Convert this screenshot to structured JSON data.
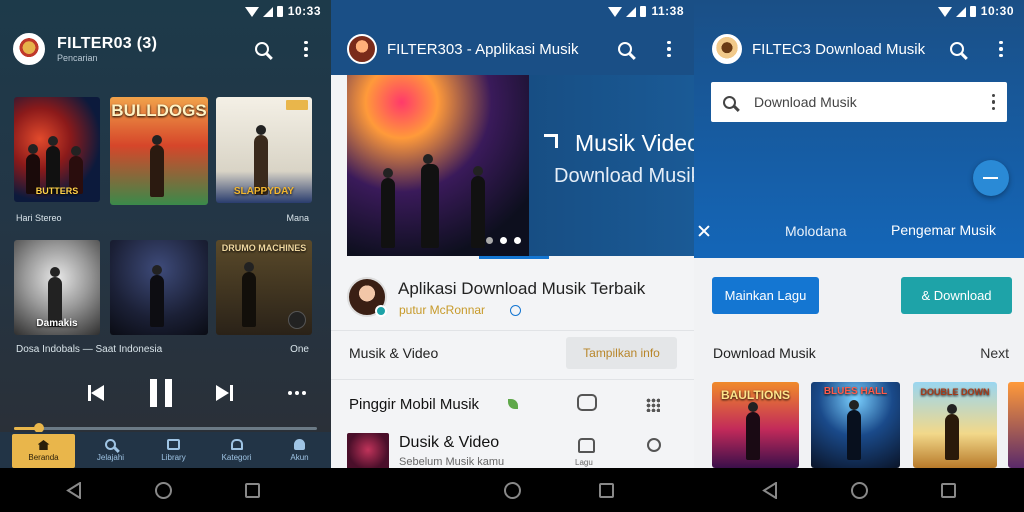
{
  "status": {
    "p1_time": "10:33",
    "p2_time": "11:38",
    "p3_time": "10:30"
  },
  "panel1": {
    "title": "FILTER03 (3)",
    "subtitle": "Pencarian",
    "row1_left": "Hari Stereo",
    "row1_right": "Mana",
    "row2_left": "Dosa Indobals — Saat Indonesia",
    "row2_right": "One",
    "art_labels": [
      "BUTTERS",
      "BULLDOGS",
      "SLAPPYDAY",
      "Damakis",
      "DRUMO MACHINES"
    ],
    "nav": [
      "Beranda",
      "Jelajahi",
      "Library",
      "Kategori",
      "Akun"
    ]
  },
  "panel2": {
    "title": "FILTER303 - Applikasi Musik",
    "hero_line1": "Musik Video",
    "hero_line2": "Download Musik",
    "profile_title": "Aplikasi Download Musik Terbaik",
    "profile_subtitle": "putur McRonnar",
    "section_label": "Musik & Video",
    "chip_label": "Tampilkan info",
    "list_title": "Pinggir Mobil Musik",
    "item_title": "Dusik & Video",
    "item_subtitle": "Sebelum Musik kamu",
    "item_side_label": "Lagu"
  },
  "panel3": {
    "title": "FILTEC3 Download Musik",
    "search_value": "Download Musik",
    "tab_left": "Molodana",
    "tab_right": "Pengemar Musik",
    "btn_primary": "Mainkan Lagu",
    "btn_secondary": "& Download",
    "section_title": "Download Musik",
    "section_more": "Next",
    "art_labels": [
      "BAULTIONS",
      "BLUES HALL",
      "DOUBLE DOWN"
    ]
  },
  "colors": {
    "primary_blue": "#1476d2",
    "dark_blue": "#0f4f8c",
    "teal": "#1ea3a8",
    "gold": "#e9b64b"
  }
}
